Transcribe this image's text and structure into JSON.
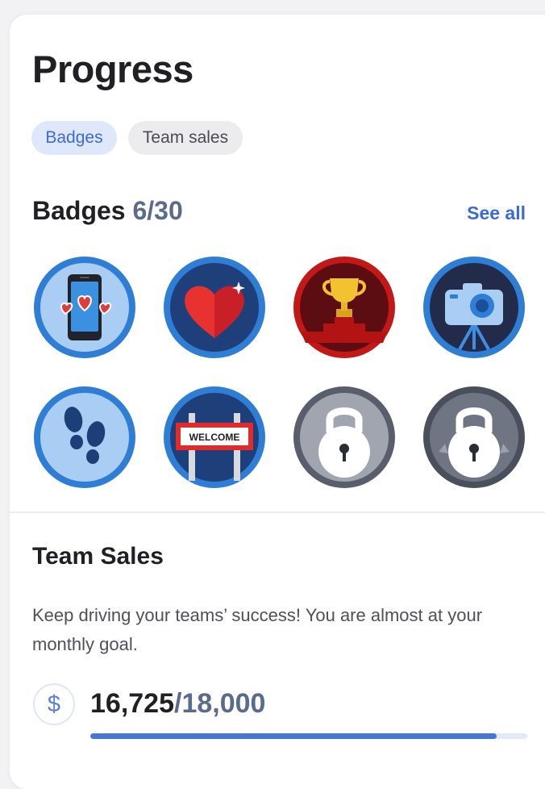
{
  "header": {
    "title": "Progress"
  },
  "tabs": [
    {
      "label": "Badges",
      "active": true
    },
    {
      "label": "Team sales",
      "active": false
    }
  ],
  "badges_section": {
    "title": "Badges",
    "count": "6/30",
    "see_all_label": "See all",
    "items": [
      {
        "icon": "phone-hearts-icon",
        "locked": false
      },
      {
        "icon": "heart-icon",
        "locked": false
      },
      {
        "icon": "trophy-icon",
        "locked": false
      },
      {
        "icon": "camera-icon",
        "locked": false
      },
      {
        "icon": "footprints-icon",
        "locked": false
      },
      {
        "icon": "welcome-sign-icon",
        "label": "WELCOME",
        "locked": false
      },
      {
        "icon": "padlock-icon",
        "locked": true
      },
      {
        "icon": "padlock-icon",
        "locked": true
      }
    ]
  },
  "team_sales": {
    "title": "Team Sales",
    "description": "Keep driving your teams’ success! You are almost at your monthly goal.",
    "currency_symbol": "$",
    "current": "16,725",
    "goal": "/18,000",
    "progress_fraction": 0.929
  },
  "colors": {
    "accent": "#3d6ad6",
    "progress": "#4577d8",
    "title": "#1f1f24",
    "muted_count": "#5a6b8c"
  }
}
